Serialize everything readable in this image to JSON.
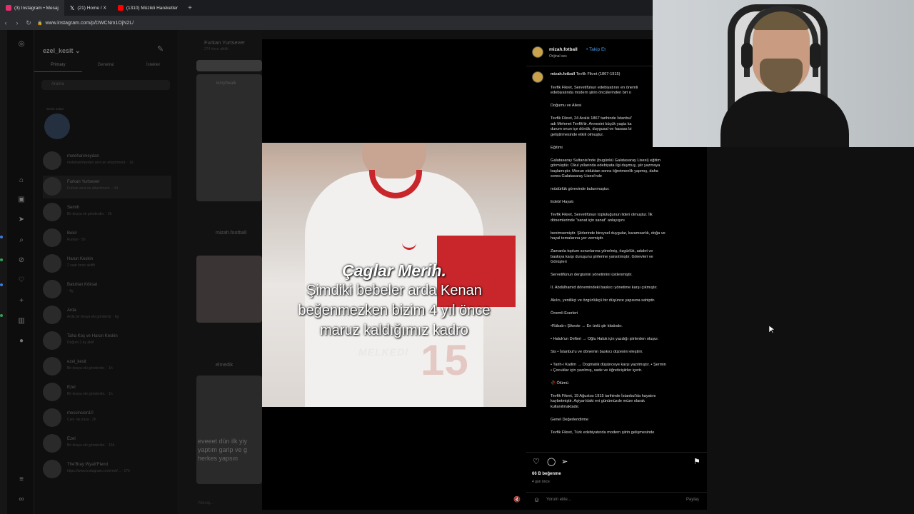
{
  "browser": {
    "tabs": [
      {
        "label": "(3) Instagram • Mesaj",
        "icon": "instagram-icon",
        "color": "#e1306c"
      },
      {
        "label": "(21) Home / X",
        "icon": "x-icon",
        "color": "#ffffff"
      },
      {
        "label": "(1310) Müzikli Hareketler",
        "icon": "youtube-icon",
        "color": "#ff0000"
      }
    ],
    "url": "www.instagram.com/p/DWCNm1OjN2L/"
  },
  "dm": {
    "username": "ezel_kesit",
    "tabs": [
      "Primary",
      "Genelral",
      "İstekler"
    ],
    "search_placeholder": "Arama",
    "note_label": "Senin notun",
    "threads": [
      {
        "name": "metehanmeydan",
        "sub": "metehanmeydan sent an attachment. · 1d"
      },
      {
        "name": "Furkan Yurtsever",
        "sub": "Furkan sent an attachment. · 4d"
      },
      {
        "name": "Semih",
        "sub": "Bir dosya ek gönderdin. · 2h"
      },
      {
        "name": "Bekir",
        "sub": "Furkan · 5h"
      },
      {
        "name": "Harun Keskin",
        "sub": "2 saat önce aktifti"
      },
      {
        "name": "Batuhan Köksal",
        "sub": "· 4g"
      },
      {
        "name": "Arda",
        "sub": "Arda bir dosya eki gönderdi. · 6g"
      },
      {
        "name": "Taha Koç ve Harun Keskin",
        "sub": "Doğum 2 ay aktif"
      },
      {
        "name": "ezel_kesit",
        "sub": "Bir dosya eki gönderdin. · 1h"
      },
      {
        "name": "Ezel",
        "sub": "Bir dosya eki gönderdin. · 1h"
      },
      {
        "name": "messinsion10",
        "sub": "Canı nie zuza · 2h"
      },
      {
        "name": "Ezel",
        "sub": "Bir dosya eki gönderdin. · 15h"
      },
      {
        "name": "The'Bray Wyatt'Fiend",
        "sub": "https://www.instagram.com/reel/... · 17h"
      }
    ]
  },
  "feed": {
    "chat_header_name": "Furkan Yurtsever",
    "chat_header_sub": "274 önce aktifti",
    "items": [
      {
        "user": "kimy0walk"
      },
      {
        "user": "mizah.football"
      },
      {
        "user": "elmedik"
      }
    ],
    "bottom_text": "eveeet dün ilk yiy yaptım garip ve g herkes yapsın",
    "message_placeholder": "Mesaj..."
  },
  "video": {
    "caption_line1": "Çaglar Merih.",
    "caption_line2": "Şimdiki bebeler arda Kenan",
    "caption_line3": "beğenmezken bizim 4 yıl önce",
    "caption_line4": "maruz kaldığımız kadro",
    "watermark": "MELKEDI",
    "jersey_number": "15"
  },
  "post": {
    "username": "mizah.fotball",
    "follow": "Takip Et",
    "audio": "Orijinal ses",
    "caption_user": "mizah.fotball",
    "caption_title": "Tevfik Fikret (1867-1915)",
    "paragraphs": [
      "Tevfik Fikret, Servetifünun edebiyatının en önemli\nedebiyatında modern şiirin öncülerinden biri o",
      "Doğumu ve Ailesi",
      "Tevfik Fikret, 24 Aralık 1867 tarihinde İstanbul'\nadı Mehmet Tevfik'tir. Annesini küçük yaşta ka\ndurum onun içe dönük, duygusal ve hassas bi\ngeliştirmesinde etkili olmuştur.",
      "Eğitimi",
      "Galatasaray Sultanisi'nde (bugünkü Galatasaray Lisesi) eğitim\ngörmüştür. Okul yıllarında edebiyata ilgi duymuş, şiir yazmaya\nbaşlamıştır. Mezun olduktan sonra öğretmenlik yapmış, daha\nsonra Galatasaray Lisesi'nde",
      "müdürlük görevinde bulunmuştur.",
      "Edebî Hayatı",
      "Tevfik Fikret, Servetifünun topluluğunun lideri olmuştur. İlk\ndönemlerinde \"sanat için sanat\" anlayışını",
      "benimsemiştir. Şiirlerinde bireysel duygular, karamsarlık, doğa ve\nhayal temalarına yer vermiştir.",
      "Zamanla toplum sorunlarına yönelmiş, özgürlük, adalet ve\nbaskıya karşı duruşunu şiirlerine yansıtmıştır. Görevleri ve\nGörüşleri",
      "Servetifünun dergisinin yönetimini üstlenmiştir.",
      "II. Abdülhamid dönemindeki baskıcı yönetime karşı çıkmıştır.",
      "Akılcı, yenilikçi ve özgürlükçü bir düşünce yapısına sahiptir.",
      "Önemli Eserleri",
      "•Rübab-ı Şikeste → En ünlü şiir kitabıdır.",
      "• Haluk'un Defteri → Oğlu Haluk için yazdığı şiirlerden oluşur.",
      "Sis • İstanbul'u ve dönemin baskıcı düzenini eleştirir.",
      "• Tarih-i Kadim → Dogmatik düşünceye karşı yazılmıştır. • Şermin\n• Çocuklar için yazılmış, sade ve öğreticişiirler içerir.",
      "🥀 Ölümü",
      "Tevfik Fikret, 19 Ağustos 1915 tarihinde İstanbul'da hayatını\nkaybetmiştir. Aşiyan'daki evi günümüzde müze olarak\nkullanılmaktadır.",
      "Genel Değerlendirme",
      "Tevfik Fikret, Türk edebiyatında modern şiirin gelişmesinde"
    ],
    "likes": "66 B beğenme",
    "time_ago": "4 gün önce",
    "comment_placeholder": "Yorum ekle...",
    "post_button": "Paylaş"
  },
  "colors": {
    "link_blue": "#4a9be8",
    "jersey_red": "#c9262b"
  }
}
